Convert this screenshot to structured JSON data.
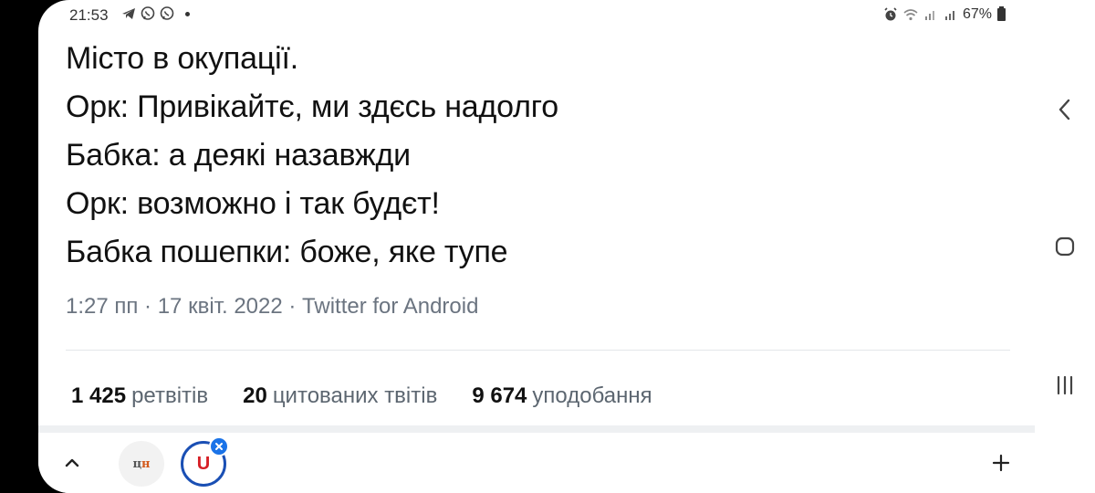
{
  "status_bar": {
    "time": "21:53",
    "icons_left": [
      "telegram-icon",
      "viber-icon",
      "viber-icon"
    ],
    "icons_right": [
      "alarm-icon",
      "wifi-icon",
      "signal-icon",
      "signal-icon"
    ],
    "battery": "67%"
  },
  "tweet": {
    "lines": [
      "Місто в окупації.",
      "Орк: Привікайтє, ми здєсь надолго",
      "Бабка: а деякі назавжди",
      "Орк: возможно і так будєт!",
      "Бабка пошепки: боже, яке тупе"
    ],
    "meta": "1:27 пп · 17 квіт. 2022 · Twitter for Android"
  },
  "stats": [
    {
      "value": "1 425",
      "label": "ретвітів"
    },
    {
      "value": "20",
      "label": "цитованих твітів"
    },
    {
      "value": "9 674",
      "label": "уподобання"
    }
  ],
  "bottom_bar": {
    "tab_cn_text_1": "ц",
    "tab_cn_text_2": "н",
    "tab_u_text": "U"
  },
  "colors": {
    "text": "#111111",
    "meta": "#6b7480",
    "accent_blue": "#1a73e8"
  }
}
